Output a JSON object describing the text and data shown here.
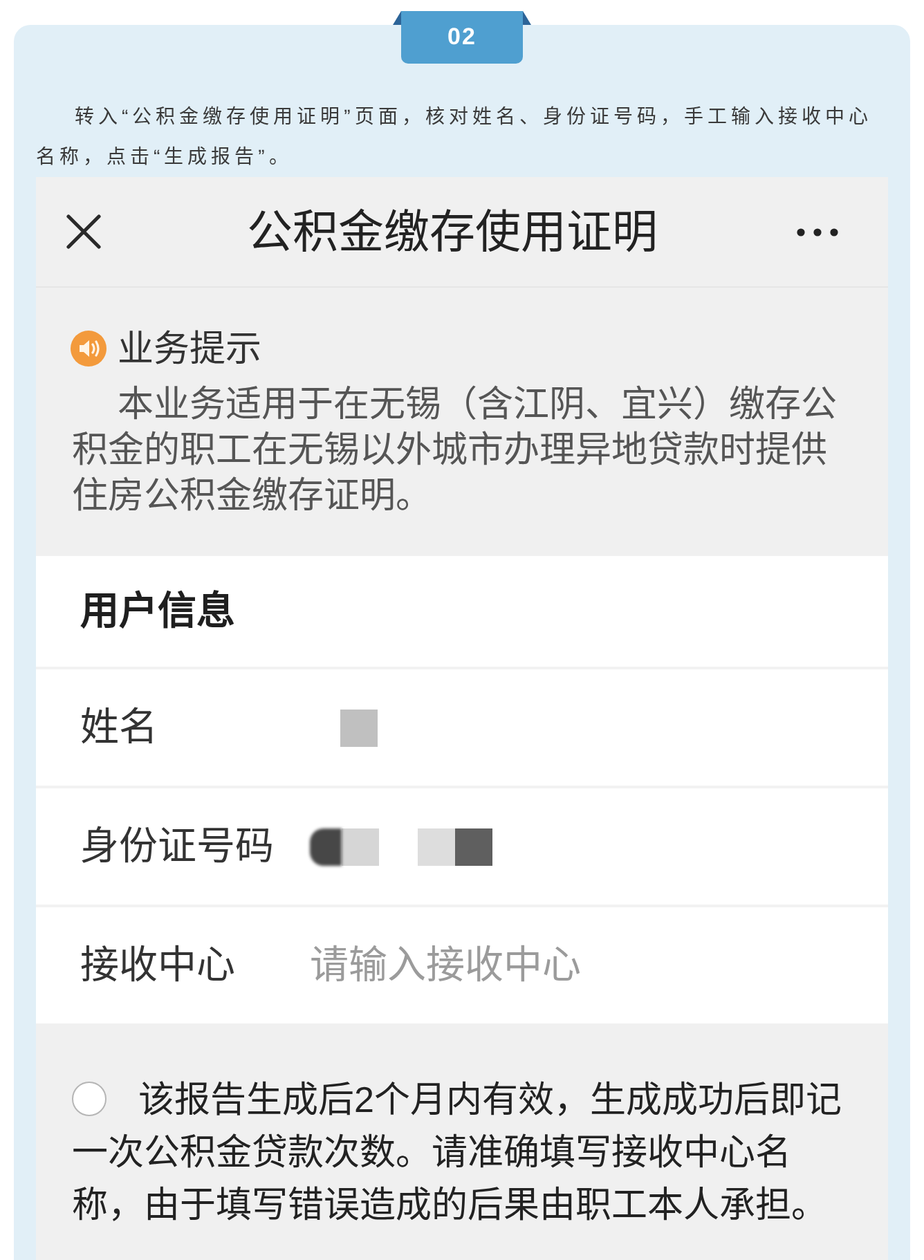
{
  "step_badge": "02",
  "intro": "转入“公积金缴存使用证明”页面，核对姓名、身份证号码，手工输入接收中心名称，点击“生成报告”。",
  "screen": {
    "title": "公积金缴存使用证明",
    "notice": {
      "heading": "业务提示",
      "text": "本业务适用于在无锡（含江阴、宜兴）缴存公积金的职工在无锡以外城市办理异地贷款时提供住房公积金缴存证明。"
    },
    "user_info": {
      "heading": "用户信息",
      "fields": [
        {
          "label": "姓名",
          "kind": "masked"
        },
        {
          "label": "身份证号码",
          "kind": "masked"
        },
        {
          "label": "接收中心",
          "kind": "input",
          "placeholder": "请输入接收中心"
        }
      ]
    },
    "agreement": {
      "checked": false,
      "text": "该报告生成后2个月内有效，生成成功后即记一次公积金贷款次数。请准确填写接收中心名称，由于填写错误造成的后果由职工本人承担。"
    }
  }
}
